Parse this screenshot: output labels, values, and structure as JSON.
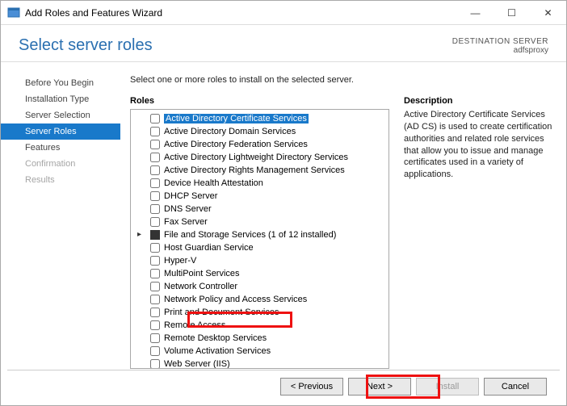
{
  "window": {
    "title": "Add Roles and Features Wizard"
  },
  "header": {
    "title": "Select server roles",
    "destination_label": "DESTINATION SERVER",
    "destination_value": "adfsproxy"
  },
  "sidebar": {
    "items": [
      {
        "label": "Before You Begin",
        "state": "normal"
      },
      {
        "label": "Installation Type",
        "state": "normal"
      },
      {
        "label": "Server Selection",
        "state": "normal"
      },
      {
        "label": "Server Roles",
        "state": "selected"
      },
      {
        "label": "Features",
        "state": "normal"
      },
      {
        "label": "Confirmation",
        "state": "disabled"
      },
      {
        "label": "Results",
        "state": "disabled"
      }
    ]
  },
  "main": {
    "instruction": "Select one or more roles to install on the selected server.",
    "roles_label": "Roles",
    "description_label": "Description",
    "description_text": "Active Directory Certificate Services (AD CS) is used to create certification authorities and related role services that allow you to issue and manage certificates used in a variety of applications.",
    "roles": [
      {
        "label": "Active Directory Certificate Services",
        "checked": false,
        "selected": true
      },
      {
        "label": "Active Directory Domain Services",
        "checked": false
      },
      {
        "label": "Active Directory Federation Services",
        "checked": false
      },
      {
        "label": "Active Directory Lightweight Directory Services",
        "checked": false
      },
      {
        "label": "Active Directory Rights Management Services",
        "checked": false
      },
      {
        "label": "Device Health Attestation",
        "checked": false
      },
      {
        "label": "DHCP Server",
        "checked": false
      },
      {
        "label": "DNS Server",
        "checked": false
      },
      {
        "label": "Fax Server",
        "checked": false
      },
      {
        "label": "File and Storage Services (1 of 12 installed)",
        "checked": "partial",
        "expandable": true
      },
      {
        "label": "Host Guardian Service",
        "checked": false
      },
      {
        "label": "Hyper-V",
        "checked": false
      },
      {
        "label": "MultiPoint Services",
        "checked": false
      },
      {
        "label": "Network Controller",
        "checked": false
      },
      {
        "label": "Network Policy and Access Services",
        "checked": false
      },
      {
        "label": "Print and Document Services",
        "checked": false
      },
      {
        "label": "Remote Access",
        "checked": false
      },
      {
        "label": "Remote Desktop Services",
        "checked": false
      },
      {
        "label": "Volume Activation Services",
        "checked": false
      },
      {
        "label": "Web Server (IIS)",
        "checked": false
      }
    ]
  },
  "footer": {
    "previous": "< Previous",
    "next": "Next >",
    "install": "Install",
    "cancel": "Cancel"
  }
}
